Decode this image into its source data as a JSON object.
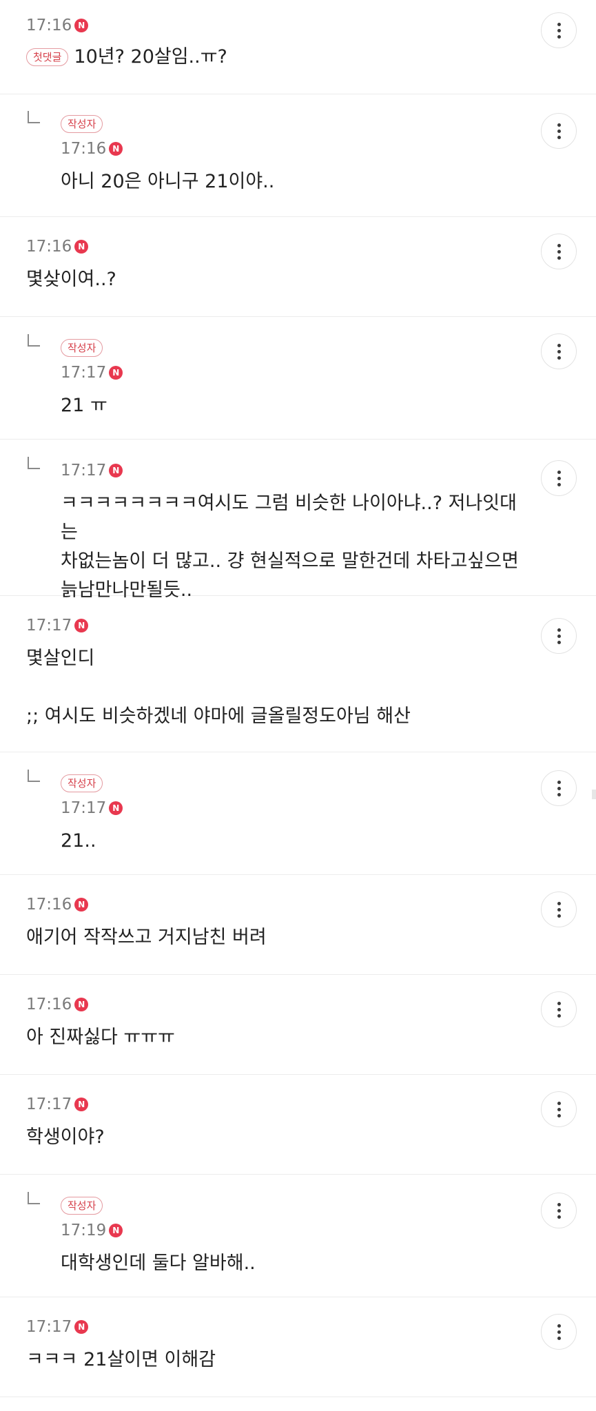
{
  "comments": [
    {
      "time": "17:16",
      "new": "N",
      "first_badge": "첫댓글",
      "text": "10년? 20살임..ㅠ?"
    },
    {
      "time": "17:16",
      "new": "N",
      "author_badge": "작성자",
      "text": "아니 20은 아니구 21이야.."
    },
    {
      "time": "17:16",
      "new": "N",
      "text": "몇샂이여..?"
    },
    {
      "time": "17:17",
      "new": "N",
      "author_badge": "작성자",
      "text": "21 ㅠ"
    },
    {
      "time": "17:17",
      "new": "N",
      "text": "ㅋㅋㅋㅋㅋㅋㅋㅋ여시도 그럼 비슷한 나이아냐..? 저나잇대는\n차없는놈이 더 많고.. 걍 현실적으로 말한건데 차타고싶으면\n늙남만나만될듯.."
    },
    {
      "time": "17:17",
      "new": "N",
      "text": "몇살인디\n\n;; 여시도 비슷하겠네 야마에 글올릴정도아님 해산"
    },
    {
      "time": "17:17",
      "new": "N",
      "author_badge": "작성자",
      "text": "21.."
    },
    {
      "time": "17:16",
      "new": "N",
      "text": "애기어 작작쓰고 거지남친 버려"
    },
    {
      "time": "17:16",
      "new": "N",
      "text": "아 진짜싫다 ㅠㅠㅠ"
    },
    {
      "time": "17:17",
      "new": "N",
      "text": "학생이야?"
    },
    {
      "time": "17:19",
      "new": "N",
      "author_badge": "작성자",
      "text": "대학생인데 둘다 알바해.."
    },
    {
      "time": "17:17",
      "new": "N",
      "text": "ㅋㅋㅋ 21살이면 이해감"
    }
  ]
}
